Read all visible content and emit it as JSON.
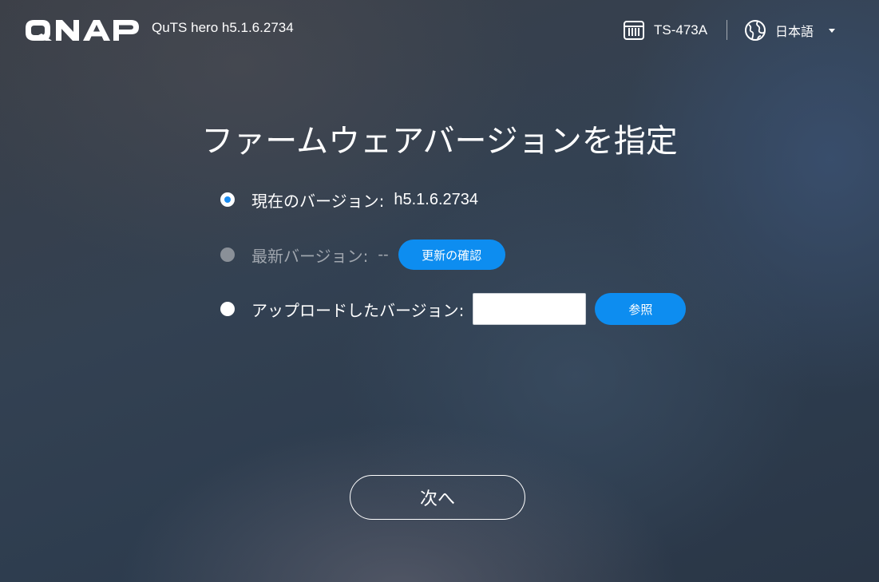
{
  "header": {
    "logo_text": "QNAP",
    "product": "QuTS hero h5.1.6.2734",
    "model": "TS-473A",
    "language": "日本語"
  },
  "main": {
    "title": "ファームウェアバージョンを指定",
    "options": [
      {
        "label": "現在のバージョン:",
        "value": "h5.1.6.2734",
        "state": "selected"
      },
      {
        "label": "最新バージョン:",
        "value": "--",
        "state": "disabled",
        "button_label": "更新の確認"
      },
      {
        "label": "アップロードしたバージョン:",
        "input_value": "",
        "state": "unselected",
        "button_label": "参照"
      }
    ],
    "next_label": "次へ"
  },
  "colors": {
    "accent": "#0d8df0",
    "radio_selected": "#1a8cf0",
    "radio_disabled": "#8a9098",
    "text": "#ffffff"
  }
}
